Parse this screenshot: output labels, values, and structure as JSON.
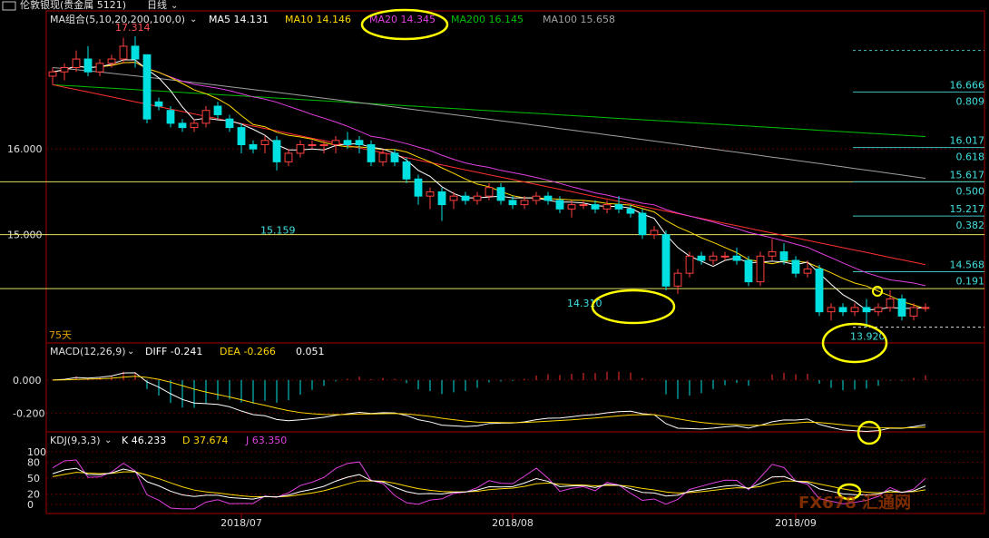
{
  "header": {
    "title": "伦敦银现(贵金属 5121)",
    "period": "日线",
    "ma_group": "MA组合(5,10,20,200,100,0)",
    "ma": [
      {
        "name": "MA5",
        "value": "14.131",
        "color": "#ffffff"
      },
      {
        "name": "MA10",
        "value": "14.146",
        "color": "#ffd700"
      },
      {
        "name": "MA20",
        "value": "14.345",
        "color": "#e040e0"
      },
      {
        "name": "MA200",
        "value": "16.145",
        "color": "#00c000"
      },
      {
        "name": "MA100",
        "value": "15.658",
        "color": "#a0a0a0"
      }
    ]
  },
  "main": {
    "ylim": [
      13.8,
      17.4
    ],
    "yticks": [
      "16.000",
      "15.000"
    ],
    "ytick_values": [
      16.0,
      15.0
    ],
    "high_label": "17.314",
    "low_labels": [
      {
        "text": "15.159",
        "value": 15.159,
        "index": 19
      },
      {
        "text": "14.310",
        "value": 14.31,
        "index": 45
      },
      {
        "text": "13.920",
        "value": 13.92,
        "index": 69
      }
    ],
    "bars_count_label": "75天",
    "fib_levels": [
      {
        "price": "16.666",
        "ratio": "0.809",
        "value": 16.666
      },
      {
        "price": "16.017",
        "ratio": "0.618",
        "value": 16.017
      },
      {
        "price": "15.617",
        "ratio": "0.500",
        "value": 15.617
      },
      {
        "price": "15.217",
        "ratio": "0.382",
        "value": 15.217
      },
      {
        "price": "14.568",
        "ratio": "0.191",
        "value": 14.568
      }
    ],
    "horizontal_lines": [
      15.617,
      15.0,
      14.37
    ],
    "top_dashed": 17.15,
    "bottom_dashed": 13.92
  },
  "macd": {
    "label": "MACD(12,26,9)",
    "diff": "DIFF -0.241",
    "dea": "DEA -0.266",
    "value": "0.051",
    "yticks": [
      "0.000",
      "-0.200"
    ],
    "ylim": [
      -0.3,
      0.13
    ]
  },
  "kdj": {
    "label": "KDJ(9,3,3)",
    "k": "K 46.233",
    "d": "D 37.674",
    "j": "J 63.350",
    "yticks": [
      "100",
      "80",
      "50",
      "20",
      "0"
    ],
    "ylim": [
      -10,
      110
    ]
  },
  "xaxis": {
    "labels": [
      {
        "text": "2018/07",
        "index": 16
      },
      {
        "text": "2018/08",
        "index": 39
      },
      {
        "text": "2018/09",
        "index": 63
      }
    ]
  },
  "watermark": "FX678 汇通网",
  "chart_data": {
    "type": "candlestick",
    "series_ohlc": [
      [
        16.85,
        16.95,
        16.75,
        16.9
      ],
      [
        16.9,
        17.0,
        16.8,
        16.95
      ],
      [
        16.95,
        17.15,
        16.9,
        17.05
      ],
      [
        17.05,
        17.2,
        16.85,
        16.9
      ],
      [
        16.9,
        17.05,
        16.85,
        17.0
      ],
      [
        17.0,
        17.1,
        16.95,
        17.05
      ],
      [
        17.05,
        17.3,
        17.0,
        17.2
      ],
      [
        17.2,
        17.314,
        16.95,
        17.05
      ],
      [
        17.1,
        17.1,
        16.3,
        16.35
      ],
      [
        16.55,
        16.6,
        16.45,
        16.5
      ],
      [
        16.45,
        16.5,
        16.25,
        16.3
      ],
      [
        16.3,
        16.35,
        16.2,
        16.25
      ],
      [
        16.25,
        16.35,
        16.2,
        16.3
      ],
      [
        16.3,
        16.5,
        16.25,
        16.45
      ],
      [
        16.5,
        16.55,
        16.35,
        16.4
      ],
      [
        16.35,
        16.4,
        16.2,
        16.25
      ],
      [
        16.25,
        16.3,
        15.95,
        16.05
      ],
      [
        16.05,
        16.1,
        15.95,
        16.0
      ],
      [
        16.05,
        16.15,
        15.95,
        16.1
      ],
      [
        16.1,
        16.15,
        15.75,
        15.85
      ],
      [
        15.85,
        16.0,
        15.8,
        15.95
      ],
      [
        15.95,
        16.1,
        15.9,
        16.05
      ],
      [
        16.05,
        16.1,
        16.0,
        16.05
      ],
      [
        16.05,
        16.1,
        15.95,
        16.05
      ],
      [
        16.05,
        16.15,
        15.95,
        16.1
      ],
      [
        16.1,
        16.2,
        16.0,
        16.05
      ],
      [
        16.1,
        16.15,
        15.95,
        16.05
      ],
      [
        16.05,
        16.1,
        15.8,
        15.85
      ],
      [
        15.85,
        16.0,
        15.8,
        15.95
      ],
      [
        15.95,
        16.0,
        15.8,
        15.85
      ],
      [
        15.85,
        15.9,
        15.6,
        15.65
      ],
      [
        15.65,
        15.7,
        15.35,
        15.45
      ],
      [
        15.45,
        15.55,
        15.3,
        15.5
      ],
      [
        15.5,
        15.55,
        15.16,
        15.35
      ],
      [
        15.4,
        15.5,
        15.3,
        15.45
      ],
      [
        15.45,
        15.5,
        15.35,
        15.4
      ],
      [
        15.4,
        15.5,
        15.35,
        15.45
      ],
      [
        15.45,
        15.6,
        15.4,
        15.55
      ],
      [
        15.55,
        15.6,
        15.35,
        15.4
      ],
      [
        15.4,
        15.45,
        15.3,
        15.35
      ],
      [
        15.35,
        15.45,
        15.3,
        15.4
      ],
      [
        15.4,
        15.5,
        15.35,
        15.45
      ],
      [
        15.45,
        15.5,
        15.35,
        15.4
      ],
      [
        15.4,
        15.45,
        15.25,
        15.3
      ],
      [
        15.3,
        15.4,
        15.2,
        15.35
      ],
      [
        15.35,
        15.4,
        15.3,
        15.35
      ],
      [
        15.35,
        15.4,
        15.25,
        15.3
      ],
      [
        15.3,
        15.4,
        15.25,
        15.35
      ],
      [
        15.35,
        15.45,
        15.25,
        15.3
      ],
      [
        15.3,
        15.35,
        15.2,
        15.25
      ],
      [
        15.25,
        15.3,
        14.95,
        15.0
      ],
      [
        15.0,
        15.1,
        14.95,
        15.05
      ],
      [
        15.0,
        15.05,
        14.35,
        14.4
      ],
      [
        14.4,
        14.6,
        14.31,
        14.55
      ],
      [
        14.55,
        14.8,
        14.5,
        14.75
      ],
      [
        14.75,
        14.8,
        14.65,
        14.7
      ],
      [
        14.7,
        14.8,
        14.65,
        14.75
      ],
      [
        14.75,
        14.8,
        14.7,
        14.75
      ],
      [
        14.75,
        14.85,
        14.65,
        14.7
      ],
      [
        14.7,
        14.75,
        14.4,
        14.45
      ],
      [
        14.45,
        14.8,
        14.4,
        14.75
      ],
      [
        14.75,
        14.95,
        14.7,
        14.8
      ],
      [
        14.8,
        14.9,
        14.65,
        14.7
      ],
      [
        14.7,
        14.75,
        14.5,
        14.55
      ],
      [
        14.55,
        14.7,
        14.5,
        14.6
      ],
      [
        14.6,
        14.65,
        14.05,
        14.1
      ],
      [
        14.1,
        14.2,
        14.0,
        14.15
      ],
      [
        14.15,
        14.2,
        14.05,
        14.1
      ],
      [
        14.1,
        14.2,
        14.05,
        14.15
      ],
      [
        14.15,
        14.25,
        13.92,
        14.1
      ],
      [
        14.1,
        14.2,
        14.05,
        14.15
      ],
      [
        14.15,
        14.35,
        14.1,
        14.25
      ],
      [
        14.25,
        14.3,
        14.0,
        14.05
      ],
      [
        14.05,
        14.2,
        14.0,
        14.15
      ],
      [
        14.15,
        14.2,
        14.1,
        14.15
      ]
    ]
  }
}
